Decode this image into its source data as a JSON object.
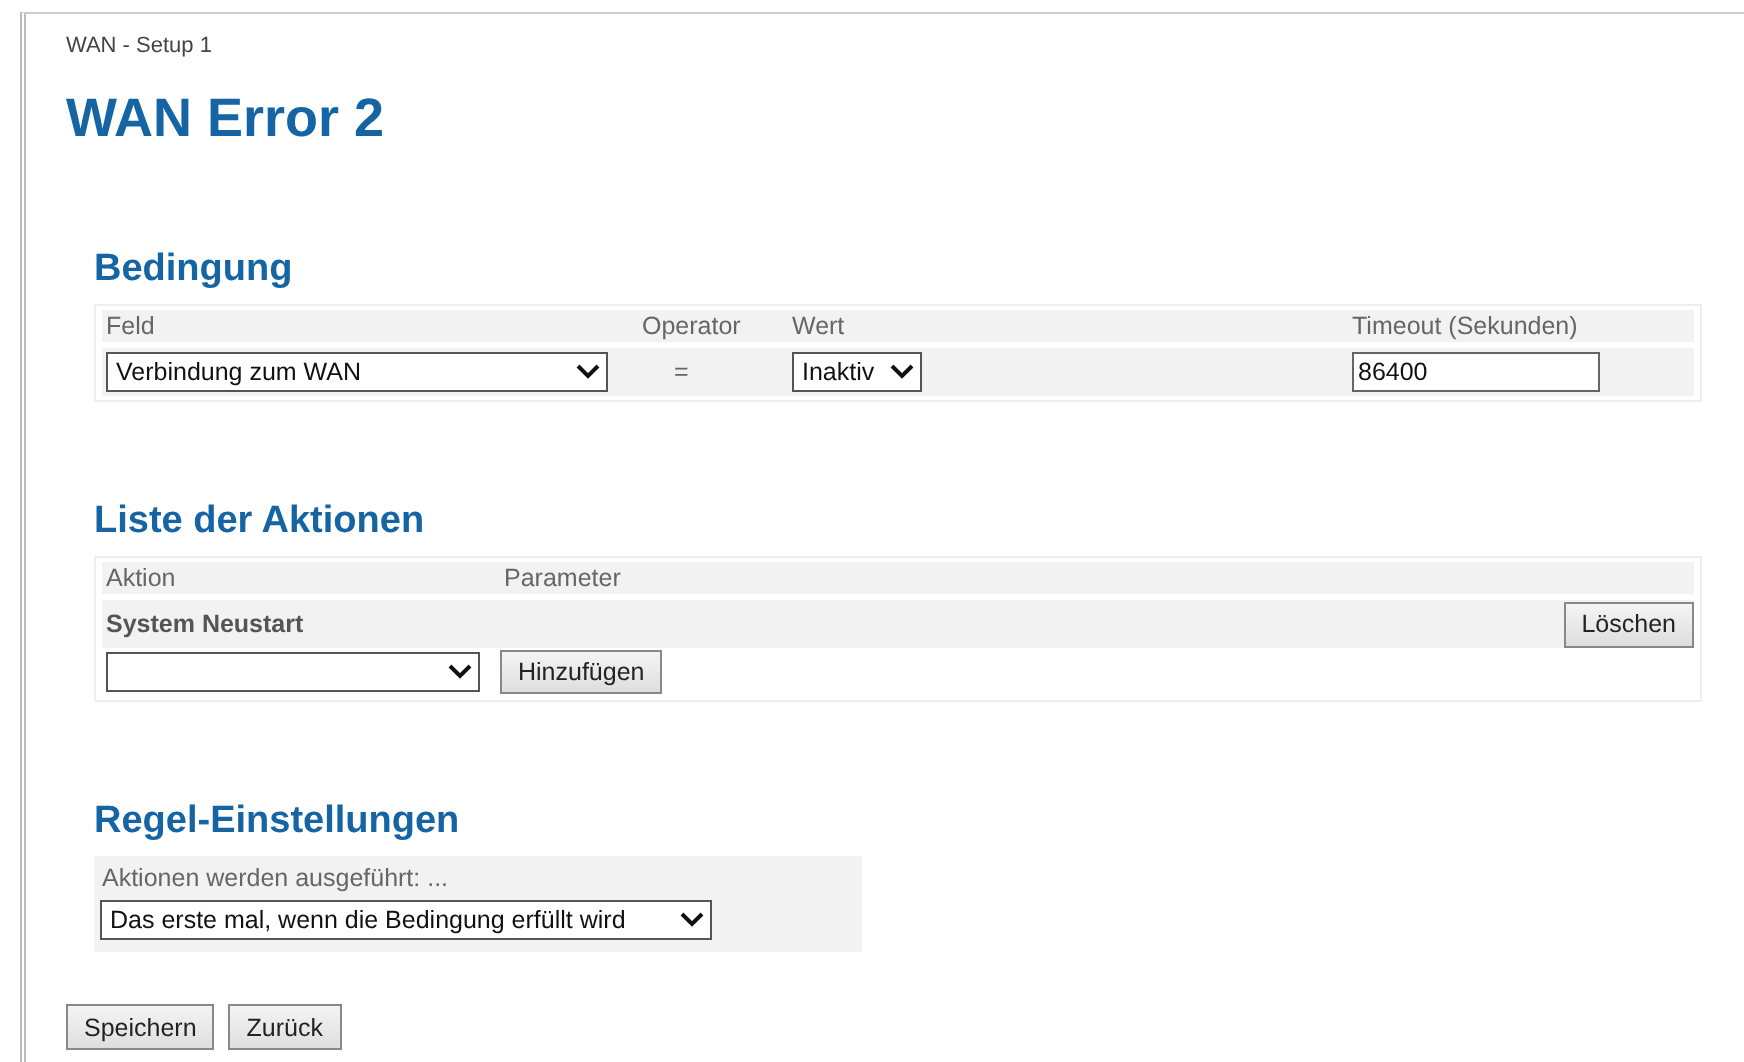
{
  "breadcrumb": "WAN - Setup 1",
  "title": "WAN Error 2",
  "condition": {
    "heading": "Bedingung",
    "columns": [
      "Feld",
      "Operator",
      "Wert",
      "Timeout (Sekunden)"
    ],
    "field": "Verbindung zum WAN",
    "operator": "=",
    "value": "Inaktiv",
    "timeout": "86400"
  },
  "actions": {
    "heading": "Liste der Aktionen",
    "columns": [
      "Aktion",
      "Parameter"
    ],
    "rows": [
      {
        "action": "System Neustart",
        "button": "Löschen"
      }
    ],
    "add_button": "Hinzufügen"
  },
  "settings": {
    "heading": "Regel-Einstellungen",
    "label": "Aktionen werden ausgeführt: ...",
    "value": "Das erste mal, wenn die Bedingung erfüllt wird"
  },
  "buttons": [
    "Speichern",
    "Zurück"
  ]
}
